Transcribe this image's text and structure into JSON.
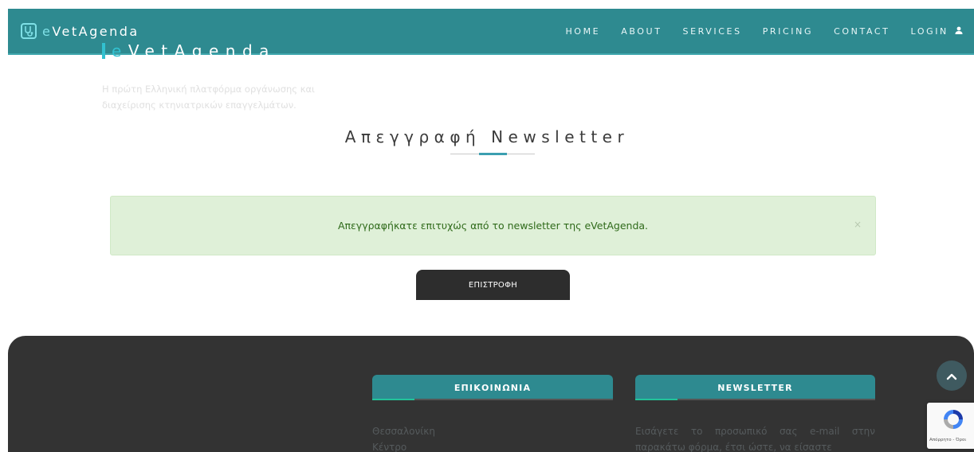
{
  "nav": {
    "brand_prefix": "e",
    "brand_name": "VetAgenda",
    "links": [
      "HOME",
      "ABOUT",
      "SERVICES",
      "PRICING",
      "CONTACT",
      "LOGIN"
    ]
  },
  "page_title": "Απεγγραφή Newsletter",
  "alert": {
    "message": "Απεγγραφήκατε επιτυχώς από το newsletter της eVetAgenda.",
    "close": "×"
  },
  "back_button": "ΕΠΙΣΤΡΟΦΗ",
  "footer": {
    "brand_prefix": "e",
    "brand_name": "VetAgenda",
    "description": "Η πρώτη Ελληνική πλατφόρμα οργάνωσης και διαχείρισης κτηνιατρικών επαγγελμάτων.",
    "contact_heading": "ΕΠΙΚΟΙΝΩΝΙΑ",
    "contact_lines": [
      "Θεσσαλονίκη",
      "Κέντρο"
    ],
    "newsletter_heading": "NEWSLETTER",
    "newsletter_text": "Εισάγετε το προσωπικό σας e-mail στην παρακάτω φόρμα, έτσι ώστε, να είσαστε"
  },
  "recaptcha_text": "Απόρρητο - Όροι",
  "colors": {
    "nav_bg": "#2e8a90",
    "accent": "#32c1d0",
    "footer_bg": "#333333",
    "alert_bg": "#dff0d8"
  },
  "icons": {
    "brand": "stethoscope-icon",
    "login": "user-icon",
    "scroll_top": "chevron-up-icon"
  }
}
